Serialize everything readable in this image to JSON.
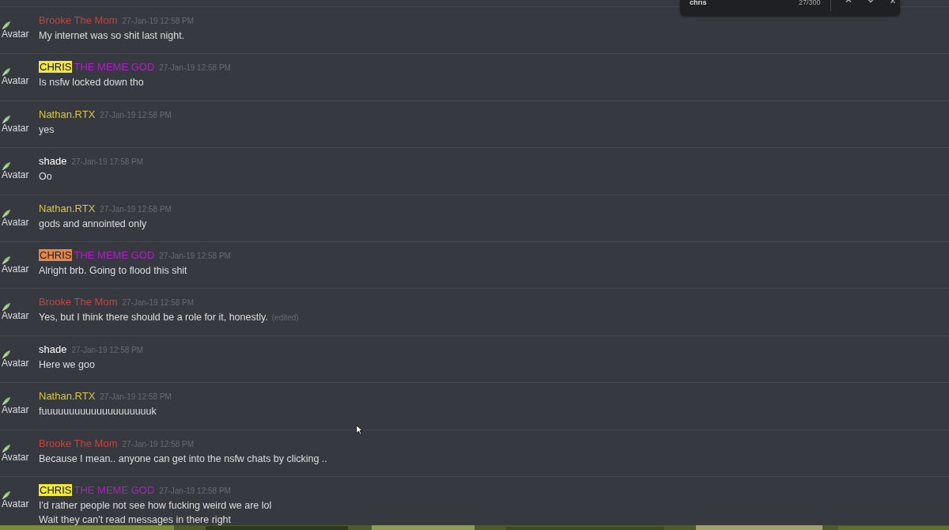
{
  "find_bar": {
    "query": "chris",
    "count": "27/300"
  },
  "messages": [
    {
      "avatar_text": "Avatar",
      "author": "Brooke The Mom",
      "color": "#c9423d",
      "timestamp": "27-Jan-19 12:58 PM",
      "lines": [
        "My internet was so shit last night."
      ]
    },
    {
      "avatar_text": "Avatar",
      "match": {
        "text": "CHRIS",
        "current": false
      },
      "author": "THE MEME GOD",
      "color": "#b21ec8",
      "timestamp": "27-Jan-19 12:58 PM",
      "lines": [
        "Is nsfw locked down tho"
      ]
    },
    {
      "avatar_text": "Avatar",
      "author": "Nathan.RTX",
      "color": "#d8c64a",
      "timestamp": "27-Jan-19 12:58 PM",
      "lines": [
        "yes"
      ]
    },
    {
      "avatar_text": "Avatar",
      "author": "shade",
      "color": "#ffffff",
      "timestamp": "27-Jan-19 17:58 PM",
      "lines": [
        "Oo"
      ]
    },
    {
      "avatar_text": "Avatar",
      "author": "Nathan.RTX",
      "color": "#d8c64a",
      "timestamp": "27-Jan-19 12:58 PM",
      "lines": [
        "gods and annointed only"
      ]
    },
    {
      "avatar_text": "Avatar",
      "match": {
        "text": "CHRIS",
        "current": true
      },
      "author": "THE MEME GOD",
      "color": "#b21ec8",
      "timestamp": "27-Jan-19 12:58 PM",
      "lines": [
        "Alright brb. Going to flood this shit"
      ]
    },
    {
      "avatar_text": "Avatar",
      "author": "Brooke The Mom",
      "color": "#c9423d",
      "timestamp": "27-Jan-19 12:58 PM",
      "lines": [
        "Yes, but I think there should be a role for it, honestly."
      ],
      "edited_label": "(edited)"
    },
    {
      "avatar_text": "Avatar",
      "author": "shade",
      "color": "#ffffff",
      "timestamp": "27-Jan-19 12:58 PM",
      "lines": [
        "Here we goo"
      ]
    },
    {
      "avatar_text": "Avatar",
      "author": "Nathan.RTX",
      "color": "#d8c64a",
      "timestamp": "27-Jan-19 12:58 PM",
      "lines": [
        "fuuuuuuuuuuuuuuuuuuuuk"
      ]
    },
    {
      "avatar_text": "Avatar",
      "author": "Brooke The Mom",
      "color": "#c9423d",
      "timestamp": "27-Jan-19 12:58 PM",
      "lines": [
        "Because I mean.. anyone can get into the nsfw chats by clicking .."
      ]
    },
    {
      "avatar_text": "Avatar",
      "match": {
        "text": "CHRIS",
        "current": false
      },
      "author": "THE MEME GOD",
      "color": "#b21ec8",
      "timestamp": "27-Jan-19 12:58 PM",
      "lines": [
        "I'd rather people not see how fucking weird we are lol",
        "Wait they can't read messages in there right"
      ]
    }
  ]
}
